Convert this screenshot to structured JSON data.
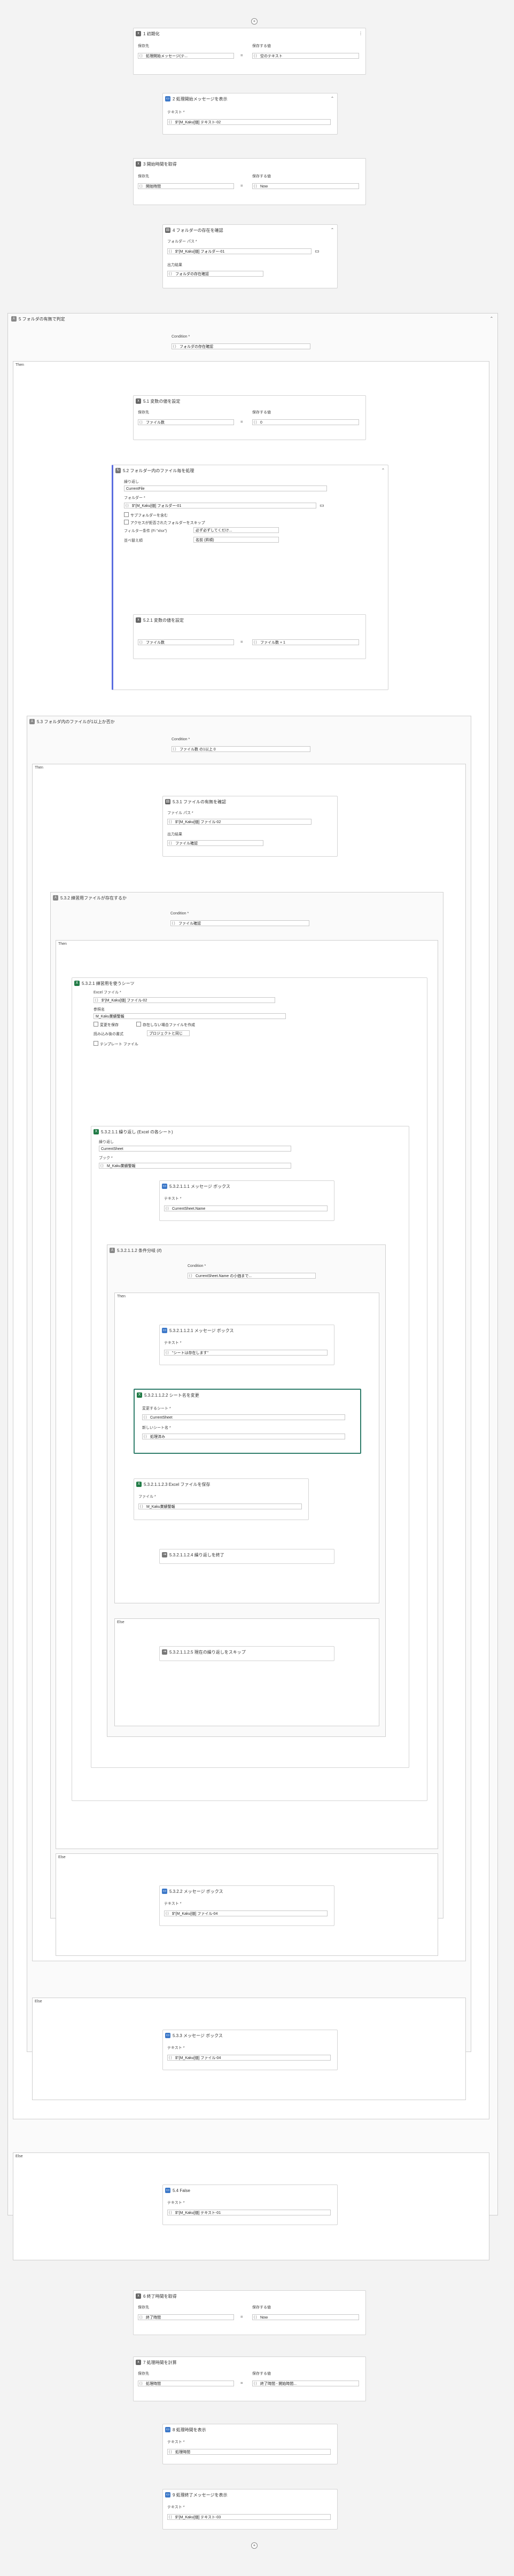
{
  "steps": {
    "s1": {
      "title": "1 初期化",
      "lhs_label": "保存先",
      "rhs_label": "保存する値",
      "lhs": "処理開始メッセージ(テ...",
      "rhs": "空のテキスト"
    },
    "s2": {
      "title": "2 処理開始メッセージを表示",
      "text_label": "テキスト *",
      "text": "$\"{M_Kaku[値] テキスト-02"
    },
    "s3": {
      "title": "3 開始時間を取得",
      "lhs_label": "保存先",
      "rhs_label": "保存する値",
      "lhs": "開始時間",
      "rhs": "Now"
    },
    "s4": {
      "title": "4 フォルダーの存在を確認",
      "path_label": "フォルダー パス *",
      "path": "$\"{M_Kaku[値] フォルダー-01",
      "out_label": "出力結果",
      "out": "フォルダの存在確認"
    },
    "s5": {
      "title": "5 フォルダの有無で判定",
      "cond_label": "Condition *",
      "cond": "フォルダの存在確認",
      "then": "Then",
      "else": "Else"
    },
    "s51": {
      "title": "5.1 変数の値を設定",
      "lhs_label": "保存先",
      "rhs_label": "保存する値",
      "lhs": "ファイル数",
      "rhs": "0"
    },
    "s52": {
      "title": "5.2 フォルダー内のファイル毎を処理",
      "iter_label": "繰り返し",
      "iter": "CurrentFile",
      "folder_label": "フォルダー *",
      "folder": "$\"{M_Kaku[値] フォルダー-01",
      "chk1": "サブフォルダーを含む",
      "chk2": "アクセスが拒否されたフォルダーをスキップ",
      "filter_label": "フィルター条件 (Fi \"xlsx\")",
      "filter": "必ず必ずしてくだけ...",
      "order_label": "並べ替え順",
      "order": "名前 (昇順)"
    },
    "s521": {
      "title": "5.2.1 変数の値を設定",
      "lhs": "ファイル数",
      "rhs": "ファイル数 + 1"
    },
    "s53": {
      "title": "5.3 フォルダ内のファイルが1以上か否か",
      "cond_label": "Condition *",
      "cond": "ファイル数  の1以上  0",
      "then": "Then",
      "else": "Else"
    },
    "s531": {
      "title": "5.3.1 ファイルの有無を確認",
      "path_label": "ファイル パス *",
      "path": "$\"{M_Kaku[値] ファイル-02",
      "out_label": "出力結果",
      "out": "ファイル確認"
    },
    "s532": {
      "title": "5.3.2 練習用ファイルが存在するか",
      "cond_label": "Condition *",
      "cond": "ファイル確認",
      "then": "Then",
      "else": "Else"
    },
    "s5321": {
      "title": "5.3.2.1 練習用を使うシーツ",
      "file_label": "Excel ファイル *",
      "file": "$\"{M_Kaku[値] ファイル-02",
      "ref_label": "参照名",
      "ref": "M_Kaku業績警報",
      "chk1": "変更を保存",
      "chk2": "存在しない場合ファイルを作成",
      "mode_label": "読み込み後の書式",
      "mode": "プロジェクトと同じ",
      "chk3": "テンプレート ファイル"
    },
    "s53211": {
      "title": "5.3.2.1.1 繰り返し (Excel の各シート)",
      "iter_label": "繰り返し",
      "iter": "CurrentSheet",
      "book_label": "ブック *",
      "book": "M_Kaku業績警報"
    },
    "s532111": {
      "title": "5.3.2.1.1.1 メッセージ ボックス",
      "text_label": "テキスト *",
      "text": "CurrentSheet.Name"
    },
    "s532112": {
      "title": "5.3.2.1.1.2 条件分岐 (if)",
      "cond_label": "Condition *",
      "cond": "CurrentSheet.Name  の小価まで...",
      "then": "Then",
      "else": "Else"
    },
    "s5321121": {
      "title": "5.3.2.1.1.2.1 メッセージ ボックス",
      "text_label": "テキスト *",
      "text": "\"シートは存在します\""
    },
    "s5321122": {
      "title": "5.3.2.1.1.2.2 シート名を変更",
      "sheet_label": "変更するシート *",
      "sheet": "CurrentSheet",
      "new_label": "新しいシート名 *",
      "new": "処理済み"
    },
    "s5321123": {
      "title": "5.3.2.1.1.2.3 Excel ファイルを保存",
      "file_label": "ファイル *",
      "file": "M_Kaku業績警報"
    },
    "s5321124": {
      "title": "5.3.2.1.1.2.4 繰り返しを終了"
    },
    "s5321125": {
      "title": "5.3.2.1.1.2.5 現在の繰り返しをスキップ"
    },
    "s5322": {
      "title": "5.3.2.2 メッセージ ボックス",
      "text_label": "テキスト *",
      "text": "$\"{M_Kaku[値] ファイル-04"
    },
    "s533": {
      "title": "5.3.3 メッセージ ボックス",
      "text_label": "テキスト *",
      "text": "$\"{M_Kaku[値] ファイル-04"
    },
    "s54": {
      "title": "5.4 False",
      "text_label": "テキスト *",
      "text": "$\"{M_Kaku[値] テキスト-01"
    },
    "s6": {
      "title": "6 終了時間を取得",
      "lhs_label": "保存先",
      "rhs_label": "保存する値",
      "lhs": "終了時間",
      "rhs": "Now"
    },
    "s7": {
      "title": "7 処理時間を計算",
      "lhs_label": "保存先",
      "rhs_label": "保存する値",
      "lhs": "処理時間",
      "rhs": "終了時間 - 開始時間..."
    },
    "s8": {
      "title": "8 処理時間を表示",
      "text_label": "テキスト *",
      "text": "処理時間"
    },
    "s9": {
      "title": "9 処理終了メッセージを表示",
      "text_label": "テキスト *",
      "text": "$\"{M_Kaku[値] テキスト-03"
    }
  },
  "icons": {
    "variable": "variable-icon",
    "message": "message-box-icon",
    "excel": "excel-icon",
    "if": "if-branch-icon",
    "loop": "loop-icon",
    "folder": "folder-icon"
  },
  "colors": {
    "selected_border": "#2f7d6b",
    "message_icon": "#3c78c8",
    "excel_icon": "#1f7a45"
  }
}
